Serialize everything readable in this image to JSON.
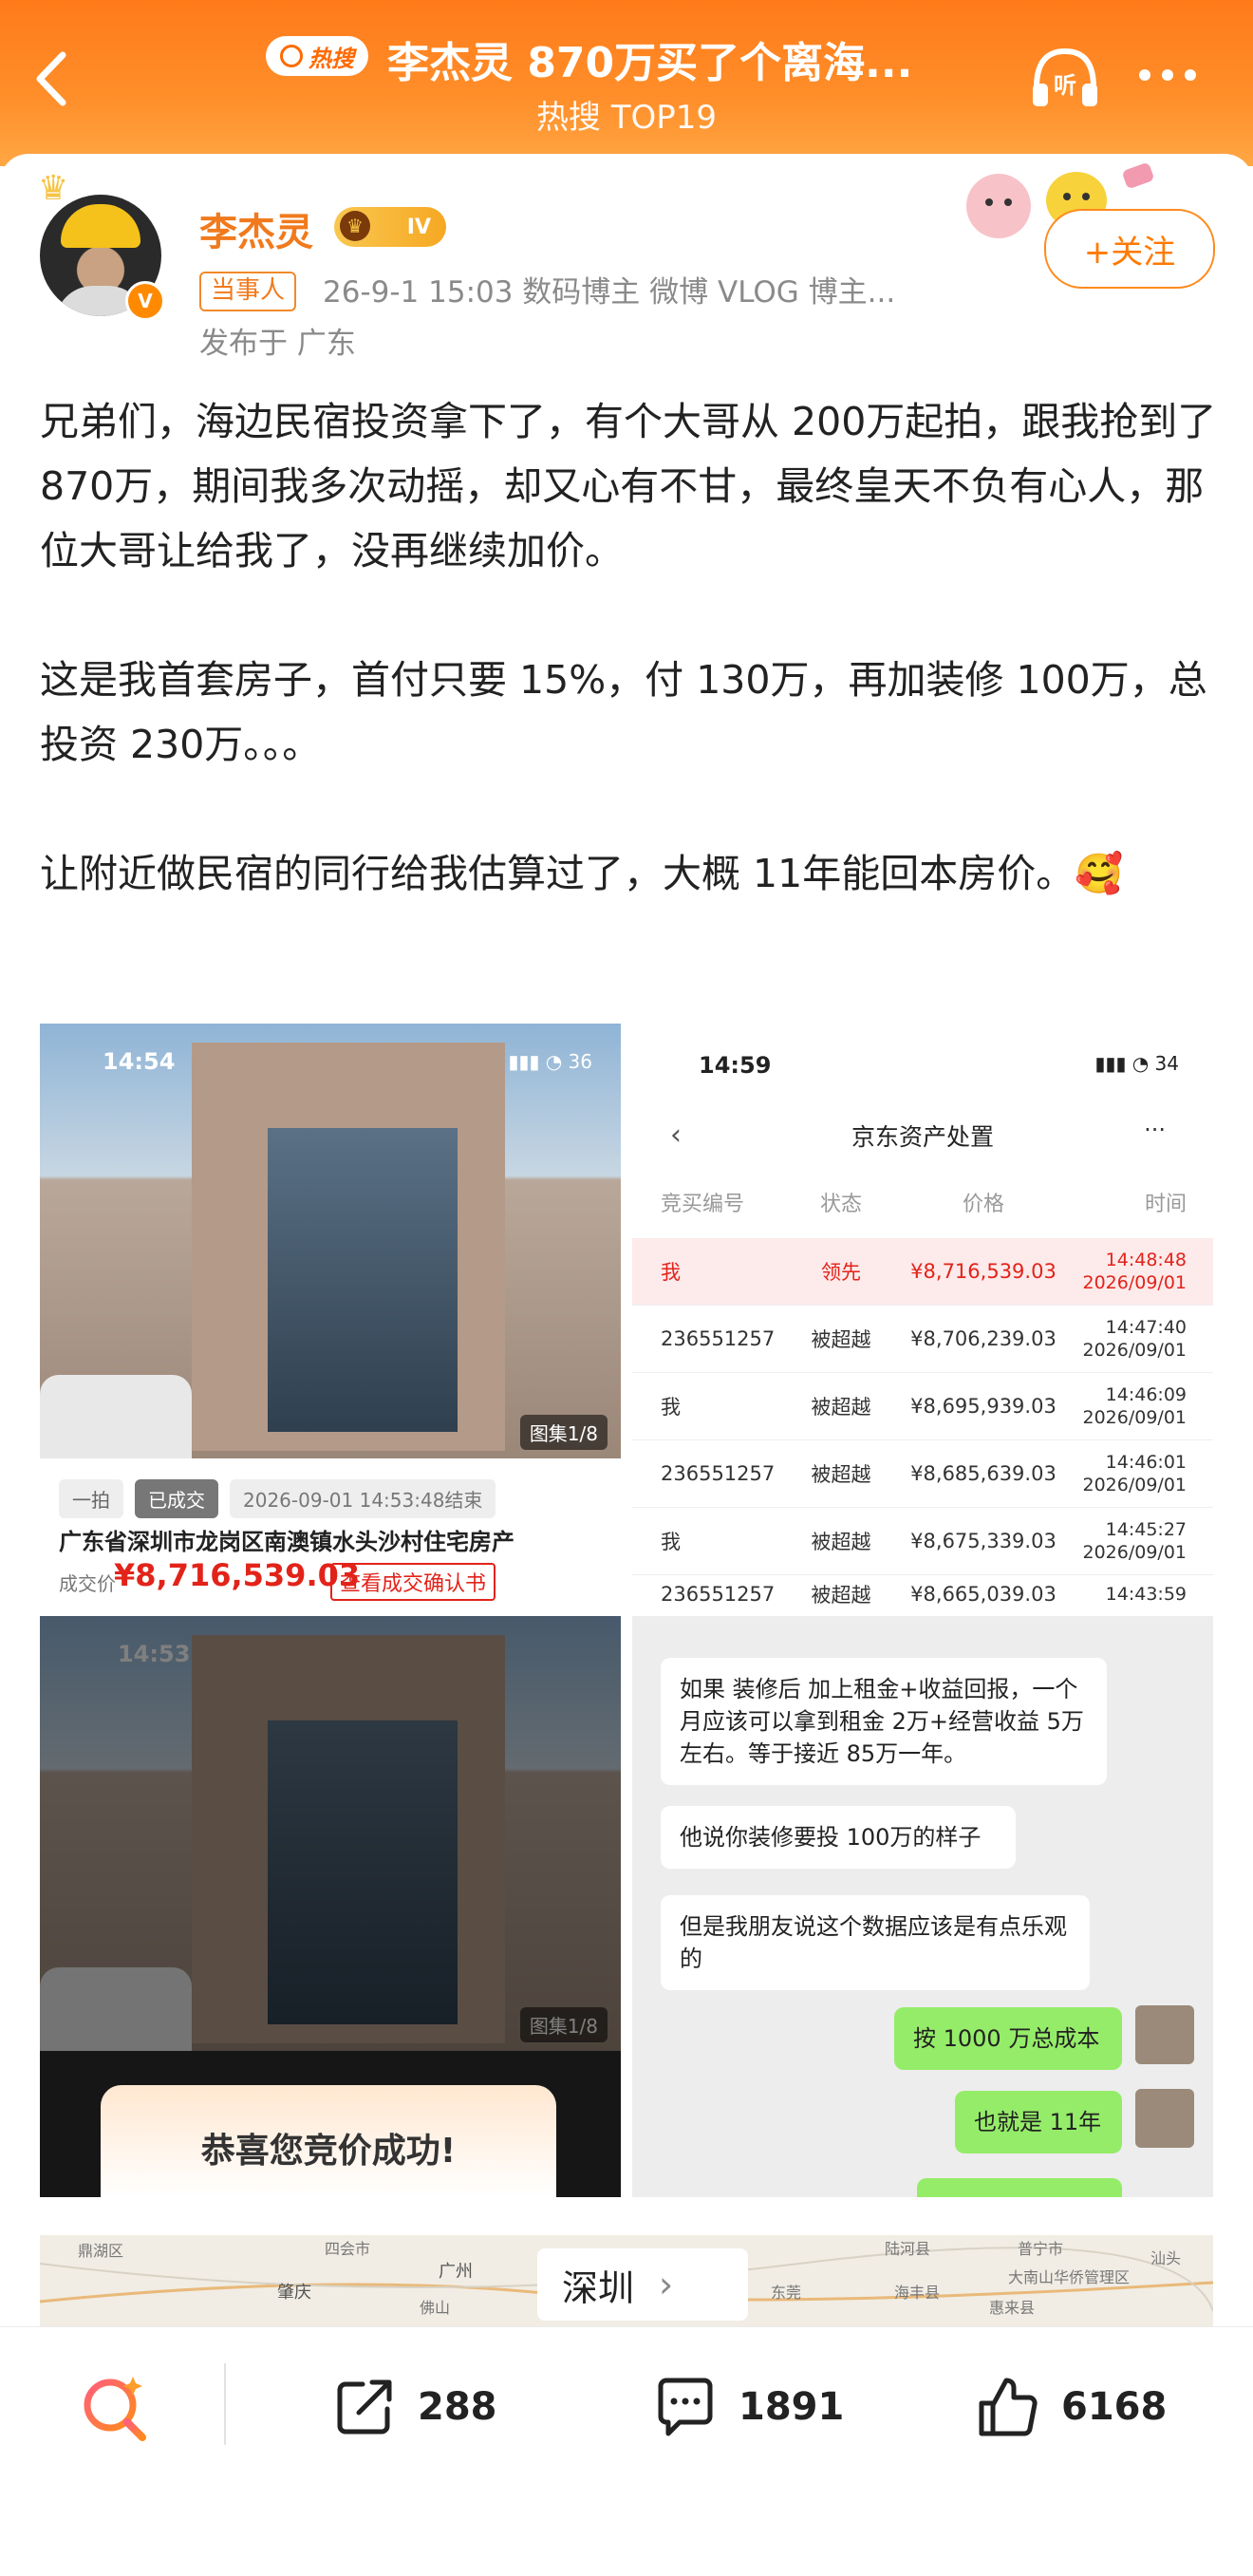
{
  "header": {
    "hot_label": "热搜",
    "title": "李杰灵 870万买了个离海...",
    "subtitle": "热搜 TOP19",
    "listen_label": "听"
  },
  "post": {
    "username": "李杰灵",
    "level": "IV",
    "verified_mark": "V",
    "party_tag": "当事人",
    "meta": "26-9-1 15:03  数码博主 微博 VLOG 博主...",
    "location": "发布于 广东",
    "follow_label": "+关注",
    "paragraphs": [
      "兄弟们，海边民宿投资拿下了，有个大哥从 200万起拍，跟我抢到了 870万，期间我多次动摇，却又心有不甘，最终皇天不负有心人，那位大哥让给我了，没再继续加价。",
      "这是我首套房子，首付只要 15%，付 130万，再加装修 100万，总投资 230万。。。",
      "让附近做民宿的同行给我估算过了，大概 11年能回本房价。"
    ],
    "emoji": "🥰"
  },
  "image1": {
    "time": "14:54",
    "signal": "36",
    "gallery": "图集1/8",
    "chip1": "一拍",
    "chip2": "已成交",
    "chip3": "2026-09-01 14:53:48结束",
    "address": "广东省深圳市龙岗区南澳镇水头沙村住宅房产",
    "deal_label": "成交价",
    "deal_price": "¥8,716,539.03",
    "deal_link": "查看成交确认书"
  },
  "image2": {
    "time": "14:59",
    "signal": "34",
    "title": "京东资产处置",
    "more": "···",
    "headers": [
      "竞买编号",
      "状态",
      "价格",
      "时间"
    ],
    "rows": [
      {
        "id": "我",
        "status": "领先",
        "price": "¥8,716,539.03",
        "time": "14:48:48",
        "date": "2026/09/01"
      },
      {
        "id": "236551257",
        "status": "被超越",
        "price": "¥8,706,239.03",
        "time": "14:47:40",
        "date": "2026/09/01"
      },
      {
        "id": "我",
        "status": "被超越",
        "price": "¥8,695,939.03",
        "time": "14:46:09",
        "date": "2026/09/01"
      },
      {
        "id": "236551257",
        "status": "被超越",
        "price": "¥8,685,639.03",
        "time": "14:46:01",
        "date": "2026/09/01"
      },
      {
        "id": "我",
        "status": "被超越",
        "price": "¥8,675,339.03",
        "time": "14:45:27",
        "date": "2026/09/01"
      },
      {
        "id": "236551257",
        "status": "被超越",
        "price": "¥8,665,039.03",
        "time": "14:43:59",
        "date": ""
      }
    ]
  },
  "image3": {
    "time": "14:53",
    "gallery": "图集1/8",
    "congrats": "恭喜您竞价成功!"
  },
  "image4": {
    "msg1": "如果 装修后 加上租金+收益回报，一个月应该可以拿到租金 2万+经营收益 5万左右。等于接近 85万一年。",
    "msg2": "他说你装修要投 100万的样子",
    "msg3": "但是我朋友说这个数据应该是有点乐观的",
    "msg4": "按 1000 万总成本",
    "msg5": "也就是 11年"
  },
  "map": {
    "city": "深圳",
    "labels": [
      "鼎湖区",
      "四会市",
      "广州",
      "陆河县",
      "普宁市",
      "汕头",
      "肇庆",
      "佛山",
      "东莞",
      "海丰县",
      "惠来县",
      "大南山华侨管理区"
    ]
  },
  "bottom_bar": {
    "share_count": "288",
    "comment_count": "1891",
    "like_count": "6168"
  }
}
